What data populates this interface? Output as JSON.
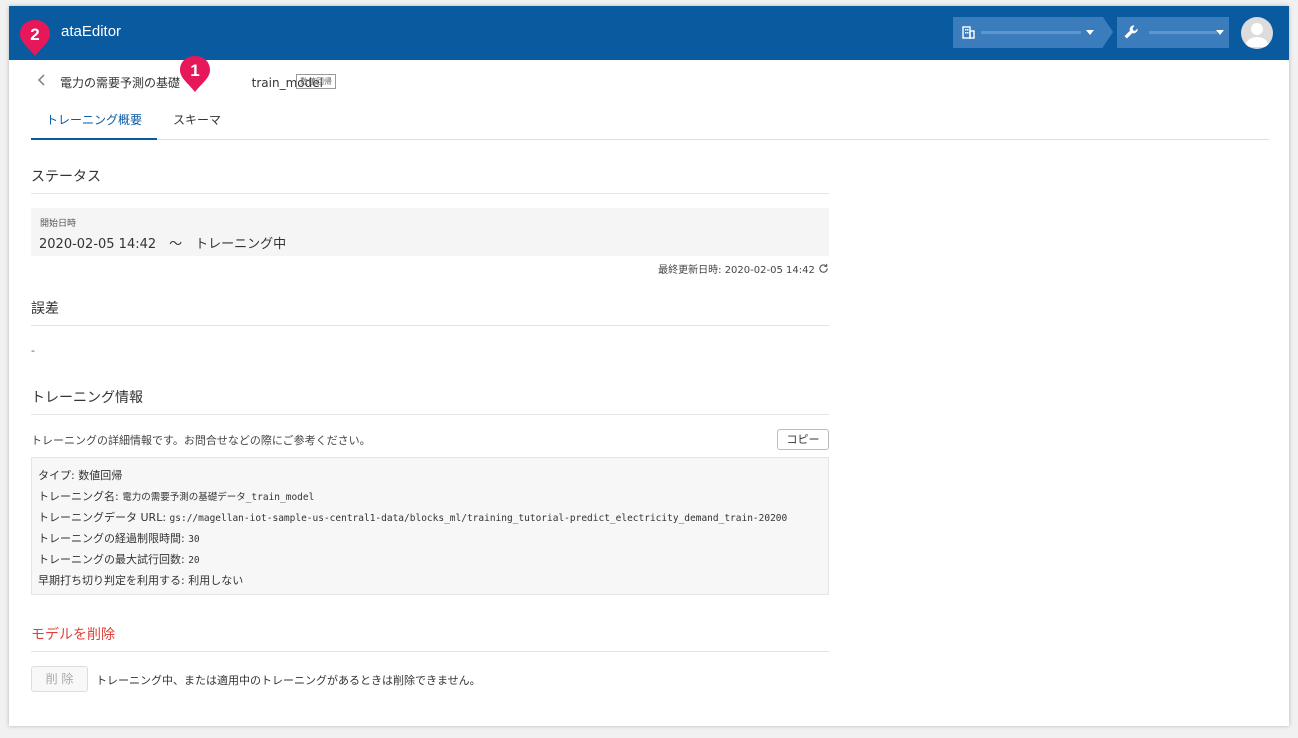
{
  "header": {
    "app_title": "ataEditor",
    "avatar": "user-avatar"
  },
  "badges": [
    "2",
    "1"
  ],
  "breadcrumb": {
    "text": "電力の需要予測の基礎",
    "suffix": "train_model",
    "tag": "数値回帰"
  },
  "tabs": [
    {
      "label": "トレーニング概要",
      "active": true
    },
    {
      "label": "スキーマ",
      "active": false
    }
  ],
  "status": {
    "title": "ステータス",
    "start_label": "開始日時",
    "start_value": "2020-02-05 14:42　～　トレーニング中",
    "updated": "最終更新日時: 2020-02-05 14:42"
  },
  "error": {
    "title": "誤差",
    "value": "-"
  },
  "training_info": {
    "title": "トレーニング情報",
    "description": "トレーニングの詳細情報です。お問合せなどの際にご参考ください。",
    "copy_label": "コピー",
    "lines": [
      {
        "label": "タイプ: ",
        "value": "数値回帰"
      },
      {
        "label": "トレーニング名: ",
        "value": "電力の需要予測の基礎データ_train_model"
      },
      {
        "label": "トレーニングデータ URL: ",
        "value": "gs://magellan-iot-sample-us-central1-data/blocks_ml/training_tutorial-predict_electricity_demand_train-20200"
      },
      {
        "label": "トレーニングの経過制限時間: ",
        "value": "30"
      },
      {
        "label": "トレーニングの最大試行回数: ",
        "value": "20"
      },
      {
        "label": "早期打ち切り判定を利用する: ",
        "value": "利用しない"
      }
    ]
  },
  "delete": {
    "title": "モデルを削除",
    "button_label": "削 除",
    "note": "トレーニング中、または適用中のトレーニングがあるときは削除できません。"
  },
  "colors": {
    "header": "#0a5aa0",
    "badge": "#e6185a",
    "delete": "#e0403a"
  }
}
